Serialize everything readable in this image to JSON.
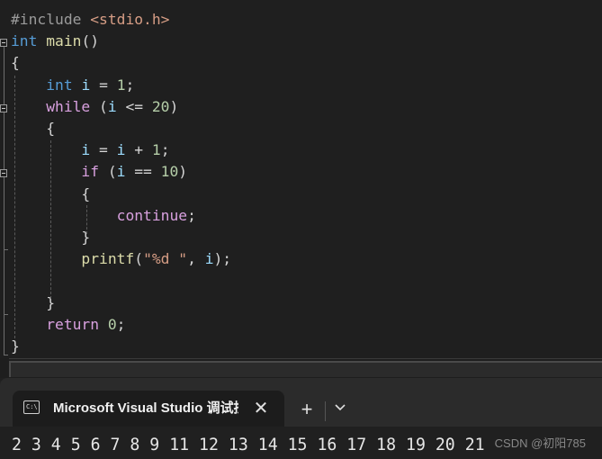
{
  "editor": {
    "lines": [
      [
        [
          "tok-pre",
          "#include "
        ],
        [
          "tok-str",
          "<stdio.h>"
        ]
      ],
      [
        [
          "tok-kw",
          "int"
        ],
        [
          "tok-punc",
          " "
        ],
        [
          "tok-fn",
          "main"
        ],
        [
          "tok-punc",
          "()"
        ]
      ],
      [
        [
          "tok-punc",
          "{"
        ]
      ],
      [
        [
          "tok-punc",
          "    "
        ],
        [
          "tok-kw",
          "int"
        ],
        [
          "tok-punc",
          " "
        ],
        [
          "tok-var",
          "i"
        ],
        [
          "tok-punc",
          " = "
        ],
        [
          "tok-num",
          "1"
        ],
        [
          "tok-punc",
          ";"
        ]
      ],
      [
        [
          "tok-punc",
          "    "
        ],
        [
          "tok-ctl",
          "while"
        ],
        [
          "tok-punc",
          " ("
        ],
        [
          "tok-var",
          "i"
        ],
        [
          "tok-punc",
          " <= "
        ],
        [
          "tok-num",
          "20"
        ],
        [
          "tok-punc",
          ")"
        ]
      ],
      [
        [
          "tok-punc",
          "    {"
        ]
      ],
      [
        [
          "tok-punc",
          "        "
        ],
        [
          "tok-var",
          "i"
        ],
        [
          "tok-punc",
          " = "
        ],
        [
          "tok-var",
          "i"
        ],
        [
          "tok-punc",
          " + "
        ],
        [
          "tok-num",
          "1"
        ],
        [
          "tok-punc",
          ";"
        ]
      ],
      [
        [
          "tok-punc",
          "        "
        ],
        [
          "tok-ctl",
          "if"
        ],
        [
          "tok-punc",
          " ("
        ],
        [
          "tok-var",
          "i"
        ],
        [
          "tok-punc",
          " == "
        ],
        [
          "tok-num",
          "10"
        ],
        [
          "tok-punc",
          ")"
        ]
      ],
      [
        [
          "tok-punc",
          "        {"
        ]
      ],
      [
        [
          "tok-punc",
          "            "
        ],
        [
          "tok-ctl",
          "continue"
        ],
        [
          "tok-punc",
          ";"
        ]
      ],
      [
        [
          "tok-punc",
          "        }"
        ]
      ],
      [
        [
          "tok-punc",
          "        "
        ],
        [
          "tok-fn",
          "printf"
        ],
        [
          "tok-punc",
          "("
        ],
        [
          "tok-str",
          "\"%d \""
        ],
        [
          "tok-punc",
          ", "
        ],
        [
          "tok-var",
          "i"
        ],
        [
          "tok-punc",
          ");"
        ]
      ],
      [],
      [
        [
          "tok-punc",
          "    }"
        ]
      ],
      [
        [
          "tok-punc",
          "    "
        ],
        [
          "tok-ctl",
          "return"
        ],
        [
          "tok-punc",
          " "
        ],
        [
          "tok-num",
          "0"
        ],
        [
          "tok-punc",
          ";"
        ]
      ],
      [
        [
          "tok-punc",
          "}"
        ]
      ]
    ]
  },
  "terminal": {
    "tab_title": "Microsoft Visual Studio 调试控制台",
    "tab_icon_text": "C:\\",
    "close_symbol": "✕",
    "new_tab_symbol": "+",
    "output": "2 3 4 5 6 7 8 9 11 12 13 14 15 16 17 18 19 20 21",
    "watermark": "CSDN @初阳785"
  },
  "icons": {
    "tab_icon": "console-icon",
    "close": "close-icon",
    "new_tab": "plus-icon",
    "dropdown": "chevron-down-icon",
    "fold": "collapse-icon"
  }
}
